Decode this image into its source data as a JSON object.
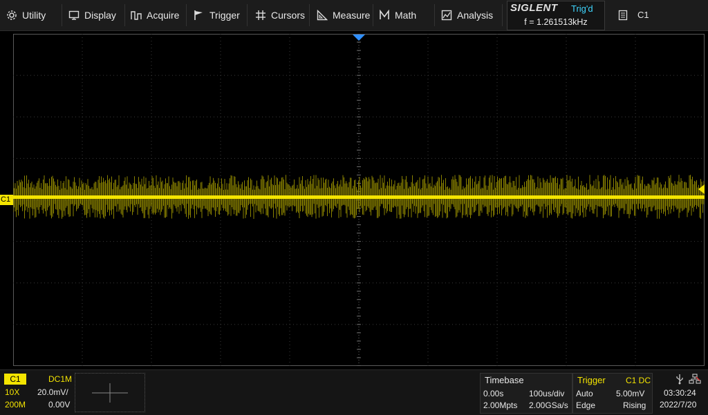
{
  "menu": {
    "utility": "Utility",
    "display": "Display",
    "acquire": "Acquire",
    "trigger": "Trigger",
    "cursors": "Cursors",
    "measure": "Measure",
    "math": "Math",
    "analysis": "Analysis"
  },
  "brand": "SIGLENT",
  "trigger_status": "Trig'd",
  "frequency": "f = 1.261513kHz",
  "channel_select": "C1",
  "waveform": {
    "channel_marker": "C1",
    "trace_color": "#f4e400",
    "trigger_marker_color": "#2f8fff"
  },
  "ch1": {
    "label": "C1",
    "coupling": "DC1M",
    "probe": "10X",
    "scale": "20.0mV/",
    "bandwidth": "200M",
    "offset": "0.00V"
  },
  "timebase": {
    "title": "Timebase",
    "delay": "0.00s",
    "scale": "100us/div",
    "memory": "2.00Mpts",
    "sample_rate": "2.00GSa/s"
  },
  "trigger_panel": {
    "title": "Trigger",
    "source": "C1 DC",
    "mode": "Auto",
    "level": "5.00mV",
    "type": "Edge",
    "slope": "Rising"
  },
  "clock": {
    "time": "03:30:24",
    "date": "2022/7/20"
  },
  "colors": {
    "accent_yellow": "#f4e400",
    "accent_blue": "#3fd6ff",
    "trigger_title": "#f4e400"
  }
}
